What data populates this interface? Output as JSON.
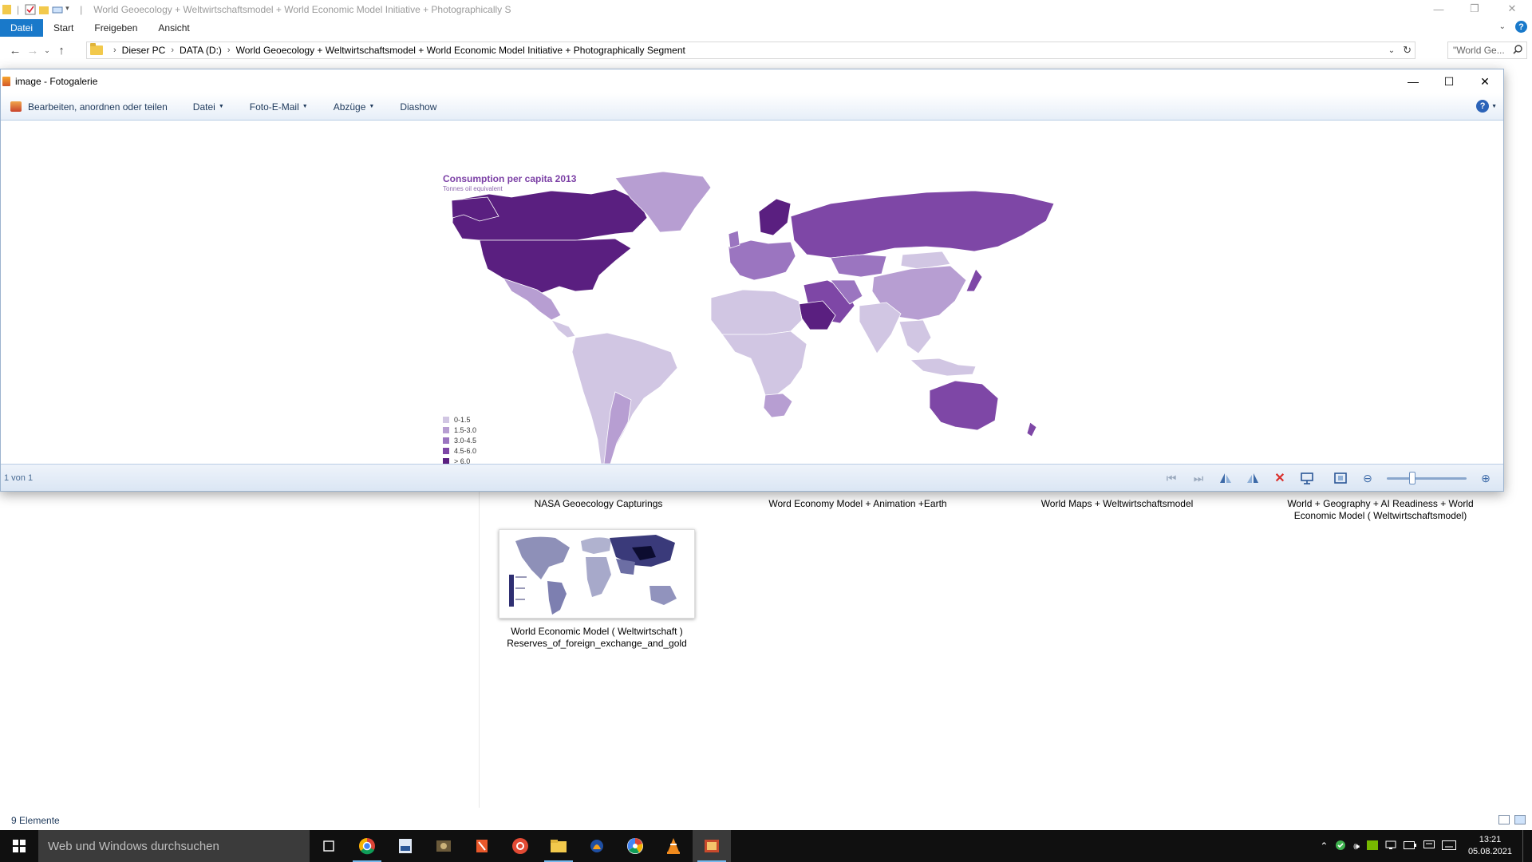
{
  "explorer": {
    "title": "World Geoecology + Weltwirtschaftsmodel + World Economic Model  Initiative + Photographically S",
    "ribbon_tabs": [
      "Datei",
      "Start",
      "Freigeben",
      "Ansicht"
    ],
    "breadcrumb": [
      "Dieser PC",
      "DATA (D:)",
      "World Geoecology + Weltwirtschaftsmodel + World Economic Model  Initiative + Photographically Segment"
    ],
    "search_placeholder": "\"World Ge...",
    "status_count": "9 Elemente",
    "thumbnails": [
      {
        "caption": "NASA Geoecology Capturings"
      },
      {
        "caption": "Word Economy Model + Animation +Earth"
      },
      {
        "caption": "World Maps + Weltwirtschaftsmodel"
      },
      {
        "caption_line1": "World + Geography + AI Readiness + World",
        "caption_line2": "Economic Model ( Weltwirtschaftsmodel)"
      },
      {
        "caption_line1": "World Economic Model ( Weltwirtschaft )",
        "caption_line2": "Reserves_of_foreign_exchange_and_gold"
      }
    ]
  },
  "gallery": {
    "title": "image - Fotogalerie",
    "toolbar": {
      "edit": "Bearbeiten, anordnen oder teilen",
      "file": "Datei",
      "email": "Foto-E-Mail",
      "prints": "Abzüge",
      "slideshow": "Diashow"
    },
    "counter": "1 von 1"
  },
  "map": {
    "title": "Consumption per capita 2013",
    "subtitle": "Tonnes oil equivalent",
    "legend": [
      {
        "label": "0-1.5",
        "color": "#d1c6e3"
      },
      {
        "label": "1.5-3.0",
        "color": "#b79ed2"
      },
      {
        "label": "3.0-4.5",
        "color": "#9b75c0"
      },
      {
        "label": "4.5-6.0",
        "color": "#7e47a6"
      },
      {
        "label": "> 6.0",
        "color": "#5a1f80"
      }
    ]
  },
  "taskbar": {
    "search_placeholder": "Web und Windows durchsuchen",
    "time": "13:21",
    "date": "05.08.2021"
  }
}
